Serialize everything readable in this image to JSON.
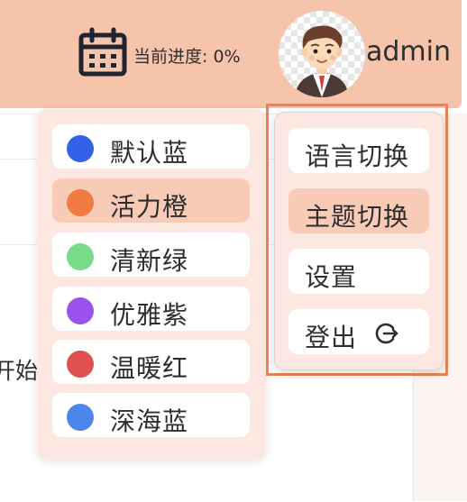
{
  "header": {
    "progress_text": "当前进度: 0%",
    "username": "admin"
  },
  "background": {
    "partial_text": "开始"
  },
  "theme_menu": {
    "items": [
      {
        "label": "默认蓝",
        "color": "#3461e8",
        "active": false
      },
      {
        "label": "活力橙",
        "color": "#f07a44",
        "active": true
      },
      {
        "label": "清新绿",
        "color": "#79da8a",
        "active": false
      },
      {
        "label": "优雅紫",
        "color": "#9b52ec",
        "active": false
      },
      {
        "label": "温暖红",
        "color": "#e05050",
        "active": false
      },
      {
        "label": "深海蓝",
        "color": "#4e86ee",
        "active": false
      }
    ]
  },
  "user_menu": {
    "items": [
      {
        "label": "语言切换",
        "active": false
      },
      {
        "label": "主题切换",
        "active": true
      },
      {
        "label": "设置",
        "active": false
      },
      {
        "label": "登出",
        "active": false
      }
    ]
  },
  "colors": {
    "header_bg": "#f6c3ab",
    "menu_bg": "#fce8e0",
    "active_item_bg": "#f8cbb7",
    "highlight_frame": "#ef7f4f"
  }
}
